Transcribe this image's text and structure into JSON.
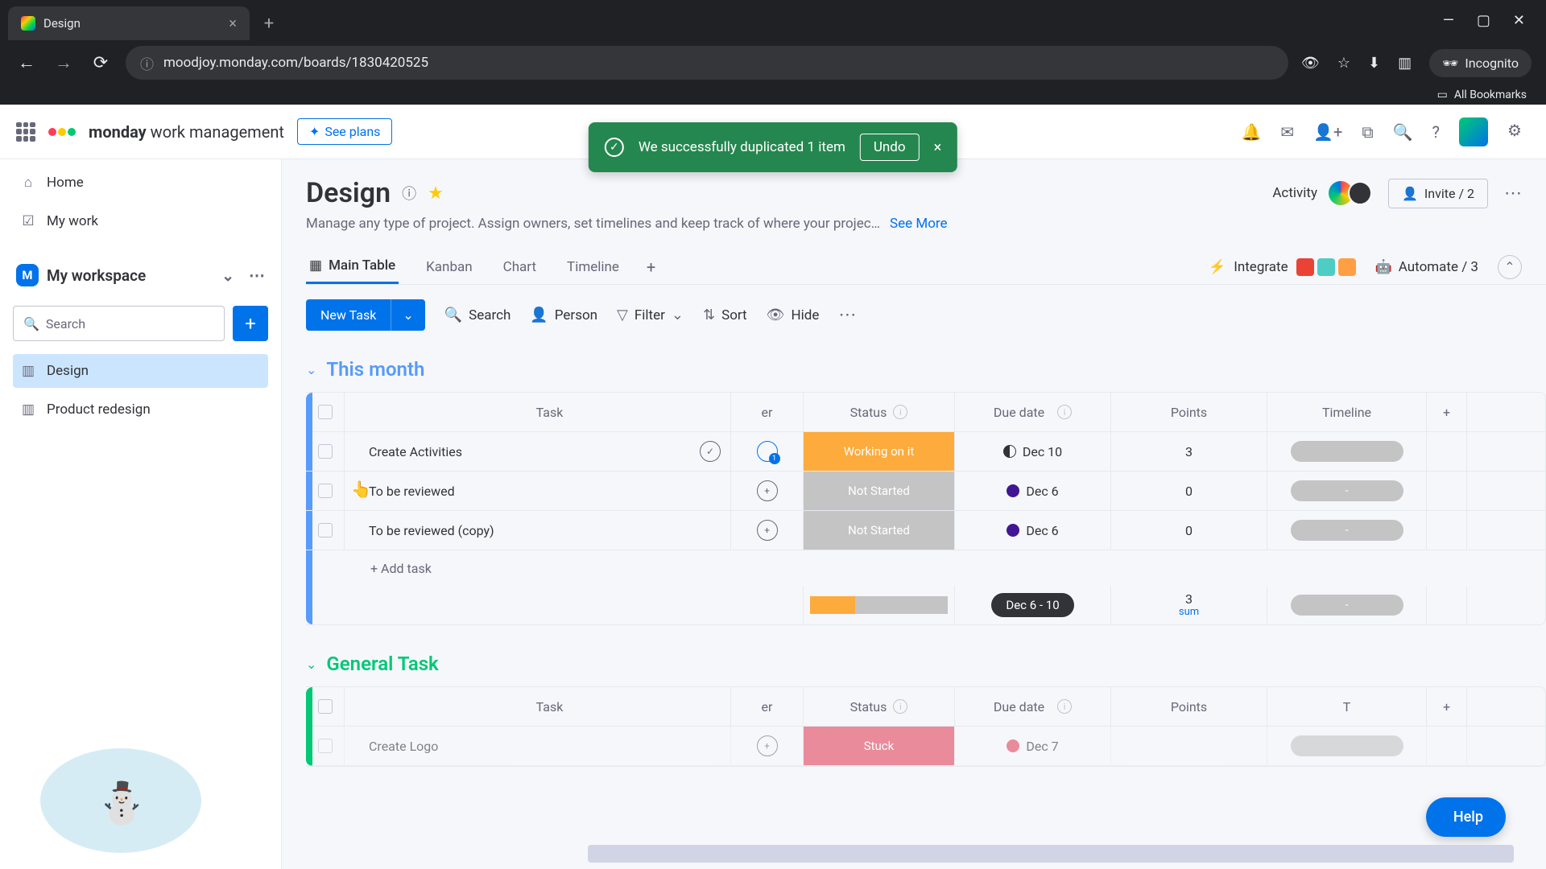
{
  "browser": {
    "tab_title": "Design",
    "url": "moodjoy.monday.com/boards/1830420525",
    "incognito": "Incognito",
    "all_bookmarks": "All Bookmarks"
  },
  "header": {
    "brand_bold": "monday",
    "brand_rest": " work management",
    "see_plans": "See plans"
  },
  "toast": {
    "message": "We successfully duplicated 1 item",
    "undo": "Undo"
  },
  "sidebar": {
    "home": "Home",
    "my_work": "My work",
    "workspace": "My workspace",
    "search_placeholder": "Search",
    "items": [
      {
        "label": "Design"
      },
      {
        "label": "Product redesign"
      }
    ]
  },
  "board": {
    "title": "Design",
    "description": "Manage any type of project. Assign owners, set timelines and keep track of where your projec…",
    "see_more": "See More",
    "activity": "Activity",
    "invite": "Invite / 2"
  },
  "tabs": {
    "main_table": "Main Table",
    "kanban": "Kanban",
    "chart": "Chart",
    "timeline": "Timeline",
    "integrate": "Integrate",
    "automate": "Automate / 3"
  },
  "toolbar": {
    "new_task": "New Task",
    "search": "Search",
    "person": "Person",
    "filter": "Filter",
    "sort": "Sort",
    "hide": "Hide"
  },
  "columns": {
    "task": "Task",
    "owner_suffix": "er",
    "status": "Status",
    "due_date": "Due date",
    "points": "Points",
    "timeline": "Timeline"
  },
  "groups": [
    {
      "name": "This month",
      "rows": [
        {
          "task": "Create Activities",
          "status": "Working on it",
          "status_class": "status-working",
          "due": "Dec 10",
          "points": "3",
          "timeline": "",
          "chat_badge": "1",
          "expand_check": true,
          "prio": "prio-half"
        },
        {
          "task": "To be reviewed",
          "status": "Not Started",
          "status_class": "status-notstarted",
          "due": "Dec 6",
          "points": "0",
          "timeline": "-",
          "prio": "prio-full",
          "has_menu": true
        },
        {
          "task": "To be reviewed (copy)",
          "status": "Not Started",
          "status_class": "status-notstarted",
          "due": "Dec 6",
          "points": "0",
          "timeline": "-",
          "prio": "prio-full"
        }
      ],
      "add_task": "+ Add task",
      "summary": {
        "date_range": "Dec 6 - 10",
        "points": "3",
        "sum_label": "sum",
        "timeline": "-"
      }
    },
    {
      "name": "General Task",
      "rows": [
        {
          "task": "Create Logo",
          "status": "Stuck",
          "status_class": "status-stuck",
          "due": "Dec 7",
          "points": "",
          "timeline": "",
          "prio": "prio-red"
        }
      ]
    }
  ],
  "help": "Help"
}
